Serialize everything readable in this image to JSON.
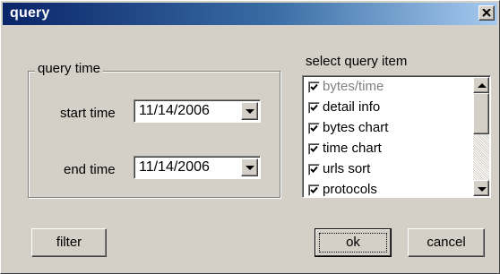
{
  "window": {
    "title": "query",
    "close_icon": "close-x-icon"
  },
  "query_time": {
    "group_label": "query time",
    "start_label": "start time",
    "start_value": "11/14/2006",
    "end_label": "end time",
    "end_value": "11/14/2006"
  },
  "query_items": {
    "label": "select query item",
    "items": [
      {
        "label": "bytes/time",
        "checked": true,
        "dimmed": true
      },
      {
        "label": "detail info",
        "checked": true
      },
      {
        "label": "bytes chart",
        "checked": true
      },
      {
        "label": "time chart",
        "checked": true
      },
      {
        "label": "urls sort",
        "checked": true
      },
      {
        "label": "protocols",
        "checked": true
      }
    ],
    "scroll_position": 0
  },
  "buttons": {
    "filter": "filter",
    "ok": "ok",
    "cancel": "cancel"
  },
  "colors": {
    "title_gradient_start": "#0a246a",
    "title_gradient_end": "#a6caf0",
    "face": "#d4d0c8"
  }
}
